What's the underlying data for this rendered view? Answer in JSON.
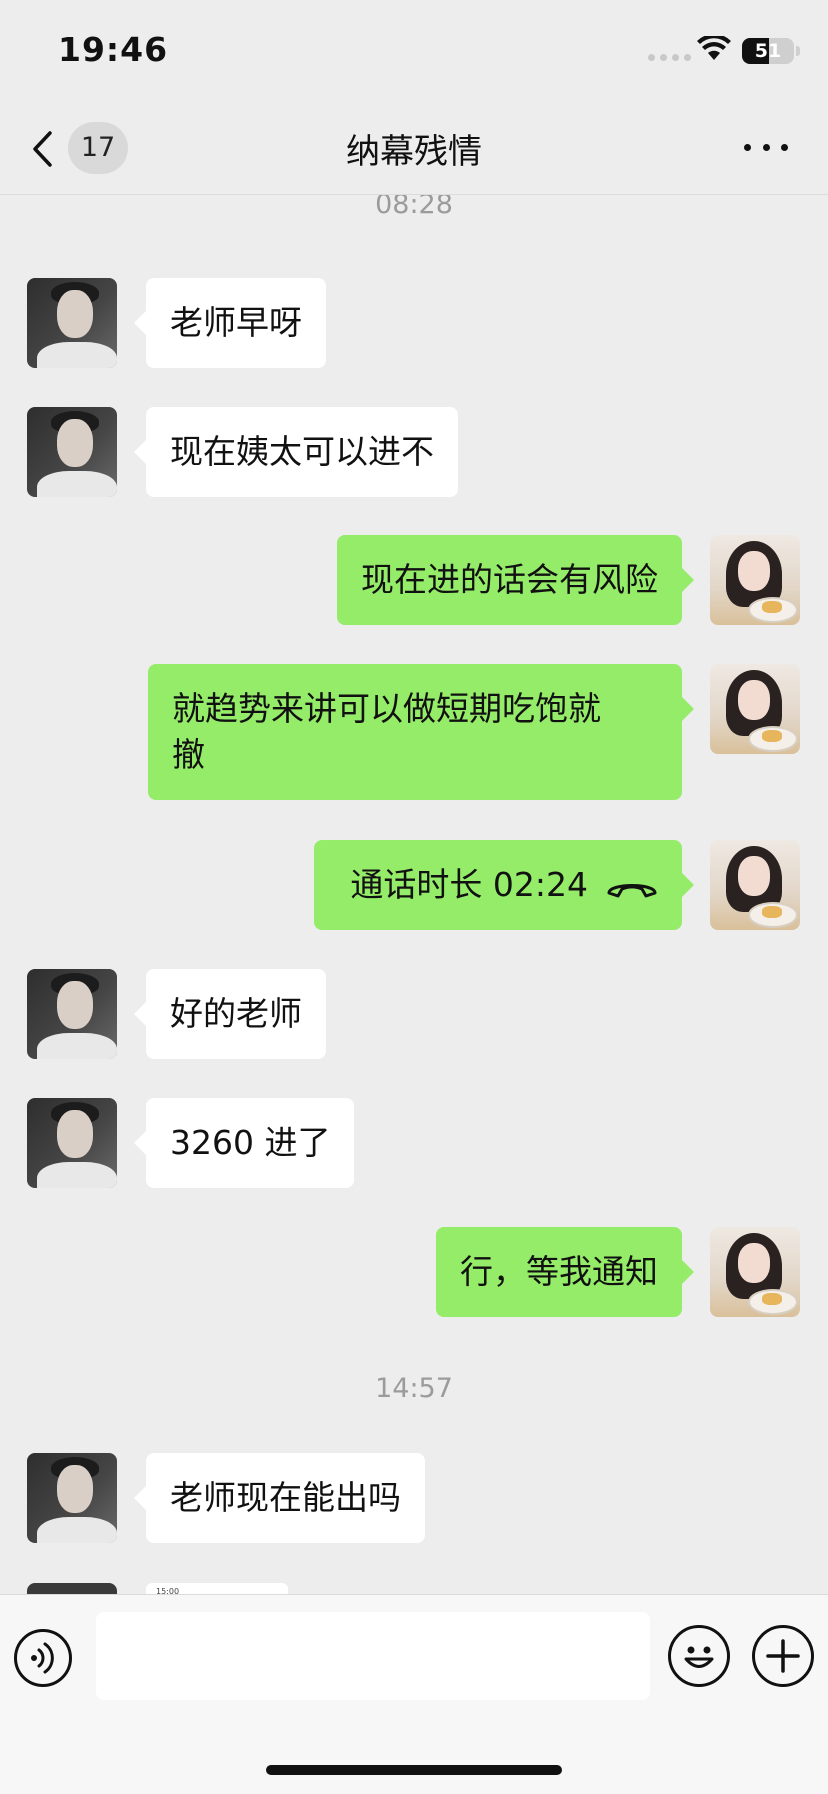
{
  "status_bar": {
    "time": "19:46",
    "battery_text": "51",
    "battery_level": 0.51
  },
  "nav": {
    "back_badge": "17",
    "title": "纳幕残情"
  },
  "chat": {
    "timestamps": [
      "08:28",
      "14:57"
    ],
    "messages": [
      {
        "side": "in",
        "text": "老师早呀"
      },
      {
        "side": "in",
        "text": "现在姨太可以进不"
      },
      {
        "side": "out",
        "text": "现在进的话会有风险"
      },
      {
        "side": "out",
        "text_line1": "就趋势来讲可以做短期吃饱就",
        "text_line2": "撤"
      },
      {
        "side": "out",
        "type": "call",
        "text": "通话时长 02:24",
        "icon": "phone-hangup-icon"
      },
      {
        "side": "in",
        "text": "好的老师"
      },
      {
        "side": "in",
        "text": "3260 进了"
      },
      {
        "side": "out",
        "text": "行，等我通知"
      },
      {
        "side": "in",
        "text": "老师现在能出吗"
      }
    ],
    "partial_image_text": "15:00"
  },
  "input_bar": {
    "placeholder": "",
    "icons": [
      "voice-icon",
      "emoji-icon",
      "plus-icon"
    ]
  },
  "colors": {
    "background": "#ededed",
    "incoming_bubble": "#ffffff",
    "outgoing_bubble": "#95ec69",
    "timestamp": "#9b9b9b"
  }
}
